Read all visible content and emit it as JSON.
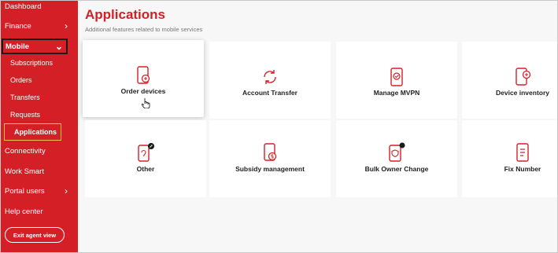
{
  "sidebar": {
    "items": [
      {
        "label": "Dashboard"
      },
      {
        "label": "Finance"
      },
      {
        "label": "Mobile"
      },
      {
        "label": "Subscriptions"
      },
      {
        "label": "Orders"
      },
      {
        "label": "Transfers"
      },
      {
        "label": "Requests"
      },
      {
        "label": "Applications"
      },
      {
        "label": "Connectivity"
      },
      {
        "label": "Work Smart"
      },
      {
        "label": "Portal users"
      },
      {
        "label": "Help center"
      }
    ],
    "exit_label": "Exit agent view"
  },
  "main": {
    "title": "Applications",
    "subtitle": "Additional features related to mobile services",
    "cards": [
      {
        "label": "Order devices",
        "icon": "order-devices-icon"
      },
      {
        "label": "Account Transfer",
        "icon": "account-transfer-icon"
      },
      {
        "label": "Manage MVPN",
        "icon": "manage-mvpn-icon"
      },
      {
        "label": "Device inventory",
        "icon": "device-inventory-icon"
      },
      {
        "label": "Other",
        "icon": "other-icon"
      },
      {
        "label": "Subsidy management",
        "icon": "subsidy-management-icon"
      },
      {
        "label": "Bulk Owner Change",
        "icon": "bulk-owner-change-icon"
      },
      {
        "label": "Fix Number",
        "icon": "fix-number-icon"
      }
    ]
  },
  "colors": {
    "brand": "#d51f26",
    "highlight": "#f2c94c"
  }
}
